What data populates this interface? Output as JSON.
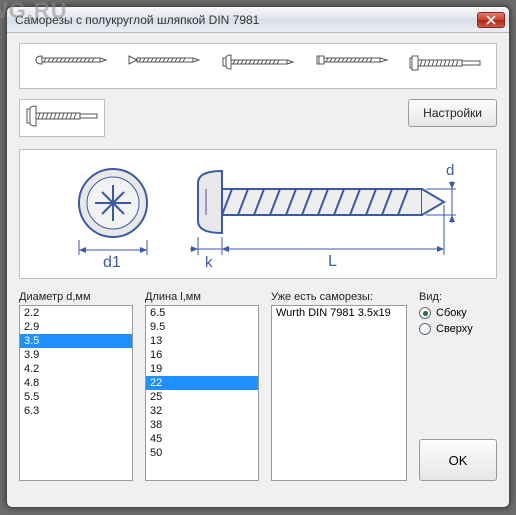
{
  "window": {
    "title": "Саморезы с полукруглой шляпкой DIN 7981"
  },
  "watermark": "DWG.RU",
  "buttons": {
    "settings": "Настройки",
    "ok": "OK"
  },
  "icons": {
    "close": "close-icon"
  },
  "labels": {
    "diameter": "Диаметр d,мм",
    "length": "Длина l,мм",
    "existing": "Уже есть саморезы:",
    "view": "Вид:"
  },
  "diameters": {
    "items": [
      "2.2",
      "2.9",
      "3.5",
      "3.9",
      "4.2",
      "4.8",
      "5.5",
      "6.3"
    ],
    "selected": "3.5"
  },
  "lengths": {
    "items": [
      "6.5",
      "9.5",
      "13",
      "16",
      "19",
      "22",
      "25",
      "32",
      "38",
      "45",
      "50"
    ],
    "selected": "22"
  },
  "existing": {
    "items": [
      "Wurth DIN 7981 3.5x19"
    ]
  },
  "view": {
    "options": [
      {
        "key": "side",
        "label": "Сбоку",
        "checked": true
      },
      {
        "key": "top",
        "label": "Сверху",
        "checked": false
      }
    ]
  },
  "diagram": {
    "dim_d1": "d1",
    "dim_k": "k",
    "dim_L": "L",
    "dim_d": "d"
  }
}
